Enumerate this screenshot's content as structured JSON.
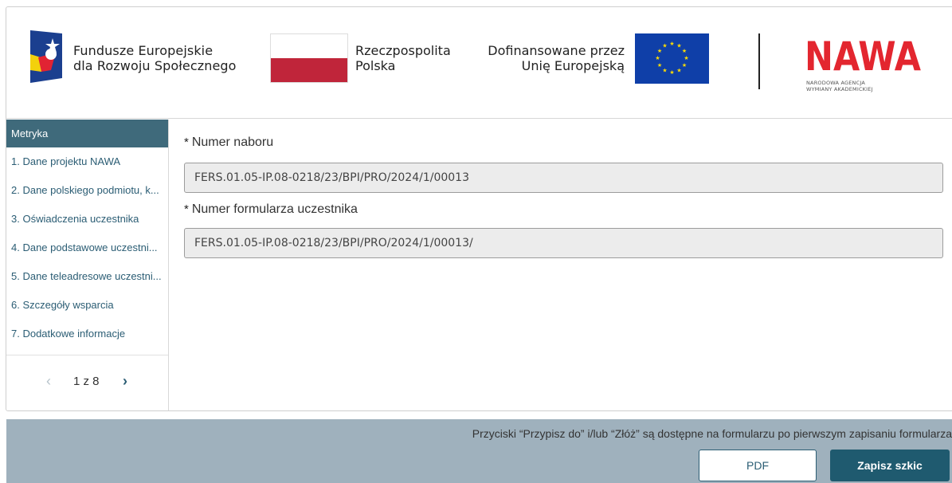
{
  "header": {
    "fe_line1": "Fundusze Europejskie",
    "fe_line2": "dla Rozwoju Społecznego",
    "rp_line1": "Rzeczpospolita",
    "rp_line2": "Polska",
    "dof_line1": "Dofinansowane przez",
    "dof_line2": "Unię Europejską",
    "nawa_logo_text": "NAWA",
    "nawa_sub1": "NARODOWA AGENCJA",
    "nawa_sub2": "WYMIANY AKADEMICKIEJ"
  },
  "sidebar": {
    "heading": "Metryka",
    "items": [
      {
        "label": "1. Dane projektu NAWA"
      },
      {
        "label": "2. Dane polskiego podmiotu, k..."
      },
      {
        "label": "3. Oświadczenia uczestnika"
      },
      {
        "label": "4. Dane podstawowe uczestni..."
      },
      {
        "label": "5. Dane teleadresowe uczestni..."
      },
      {
        "label": "6. Szczegóły wsparcia"
      },
      {
        "label": "7. Dodatkowe informacje"
      }
    ],
    "pager": {
      "text": "1 z 8",
      "prev": "‹",
      "next": "›"
    }
  },
  "form": {
    "required_mark": "*",
    "field1": {
      "label": "Numer naboru",
      "value": "FERS.01.05-IP.08-0218/23/BPI/PRO/2024/1/00013"
    },
    "field2": {
      "label": "Numer formularza uczestnika",
      "value": "FERS.01.05-IP.08-0218/23/BPI/PRO/2024/1/00013/"
    }
  },
  "footer": {
    "note": "Przyciski “Przypisz do” i/lub “Złóż” są dostępne na formularzu po pierwszym zapisaniu formularza",
    "pdf_label": "PDF",
    "save_label": "Zapisz szkic"
  },
  "colors": {
    "sidebar_heading_bg": "#3f6a7b",
    "link": "#2b5d74",
    "footer_bg": "#9fb1bd",
    "primary_button": "#1f5a6f",
    "nawa_red": "#e3262f",
    "eu_blue": "#0f3fa8"
  }
}
